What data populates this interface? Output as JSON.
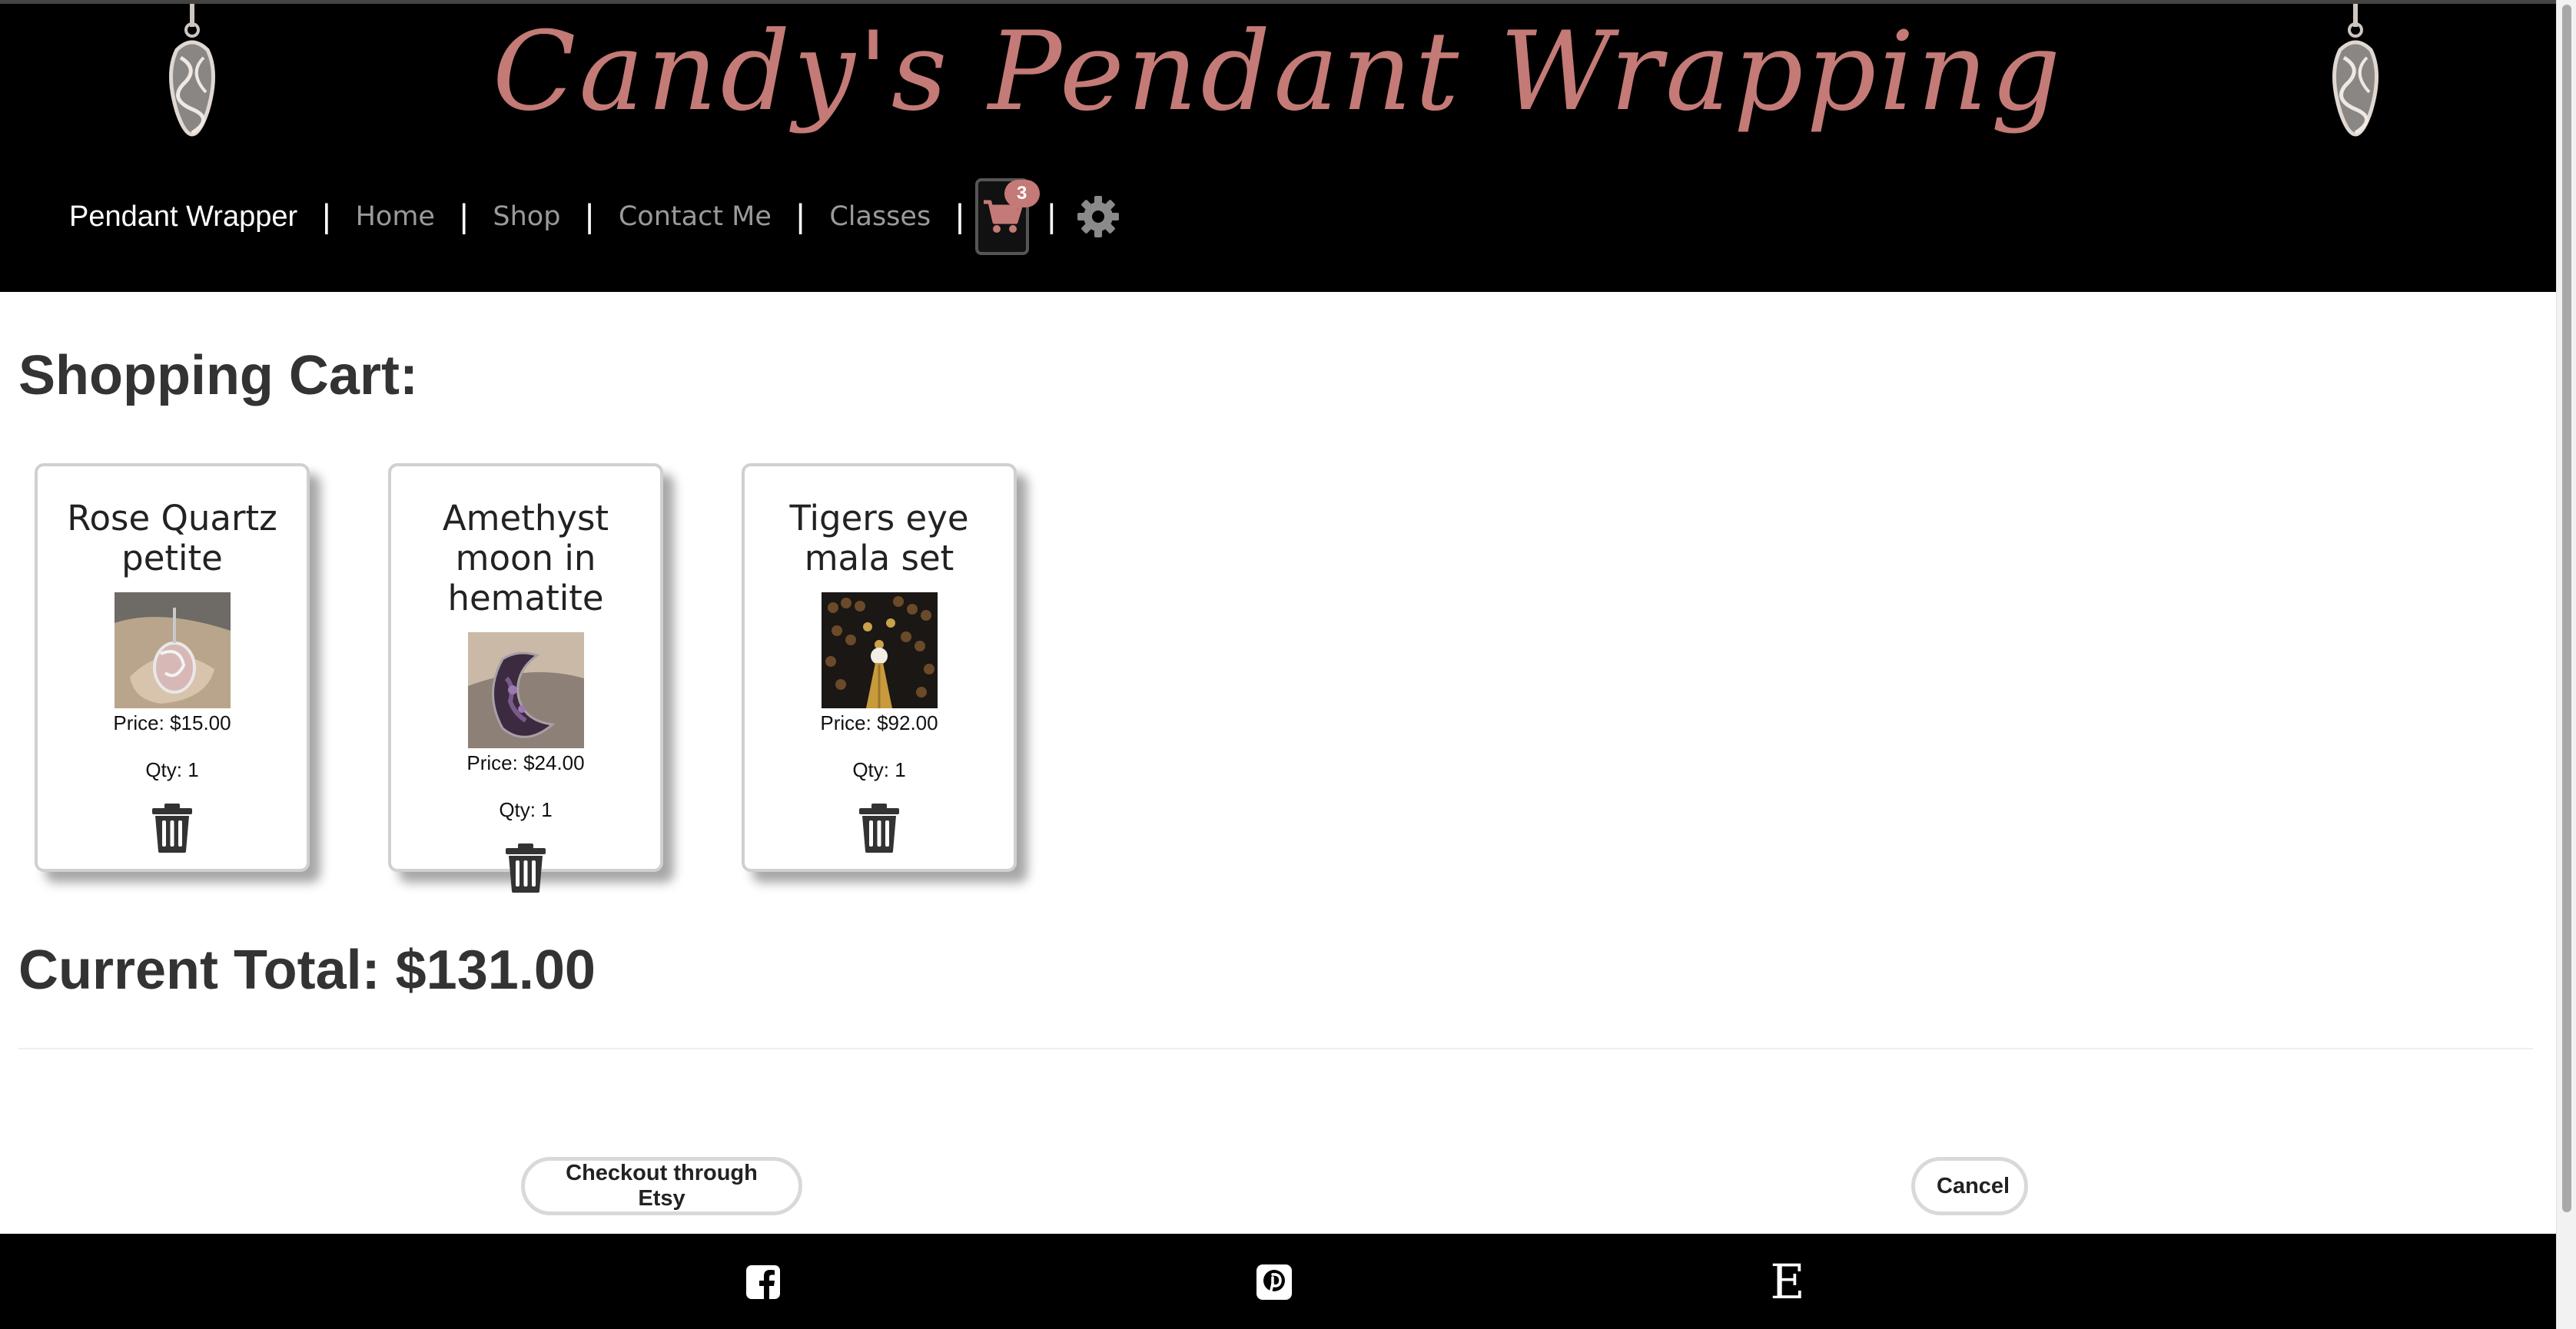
{
  "header": {
    "site_title": "Candy's Pendant Wrapping",
    "decor_icon": "wire-wrapped-pendant-icon"
  },
  "nav": {
    "brand": "Pendant Wrapper",
    "links": [
      "Home",
      "Shop",
      "Contact Me",
      "Classes"
    ],
    "separator": "|",
    "cart_icon": "shopping-cart-icon",
    "cart_count": "3",
    "settings_icon": "gear-icon"
  },
  "cart": {
    "heading": "Shopping Cart:",
    "items": [
      {
        "name": "Rose Quartz petite",
        "price": "Price: $15.00",
        "qty": "Qty: 1",
        "image": "rose-quartz-pendant-photo"
      },
      {
        "name": "Amethyst moon in hematite",
        "price": "Price: $24.00",
        "qty": "Qty: 1",
        "image": "amethyst-moon-pendant-photo"
      },
      {
        "name": "Tigers eye mala set",
        "price": "Price: $92.00",
        "qty": "Qty: 1",
        "image": "tigers-eye-mala-photo"
      }
    ],
    "delete_icon": "trash-icon",
    "total": "Current Total: $131.00"
  },
  "actions": {
    "checkout_label": "Checkout through Etsy",
    "cancel_label": "Cancel"
  },
  "footer": {
    "icons": [
      "facebook-icon",
      "pinterest-icon",
      "etsy-icon"
    ],
    "etsy_letter": "E"
  },
  "colors": {
    "accent": "#c47a76",
    "header_bg": "#000000",
    "nav_link": "#9a9a9a",
    "text": "#333333"
  }
}
